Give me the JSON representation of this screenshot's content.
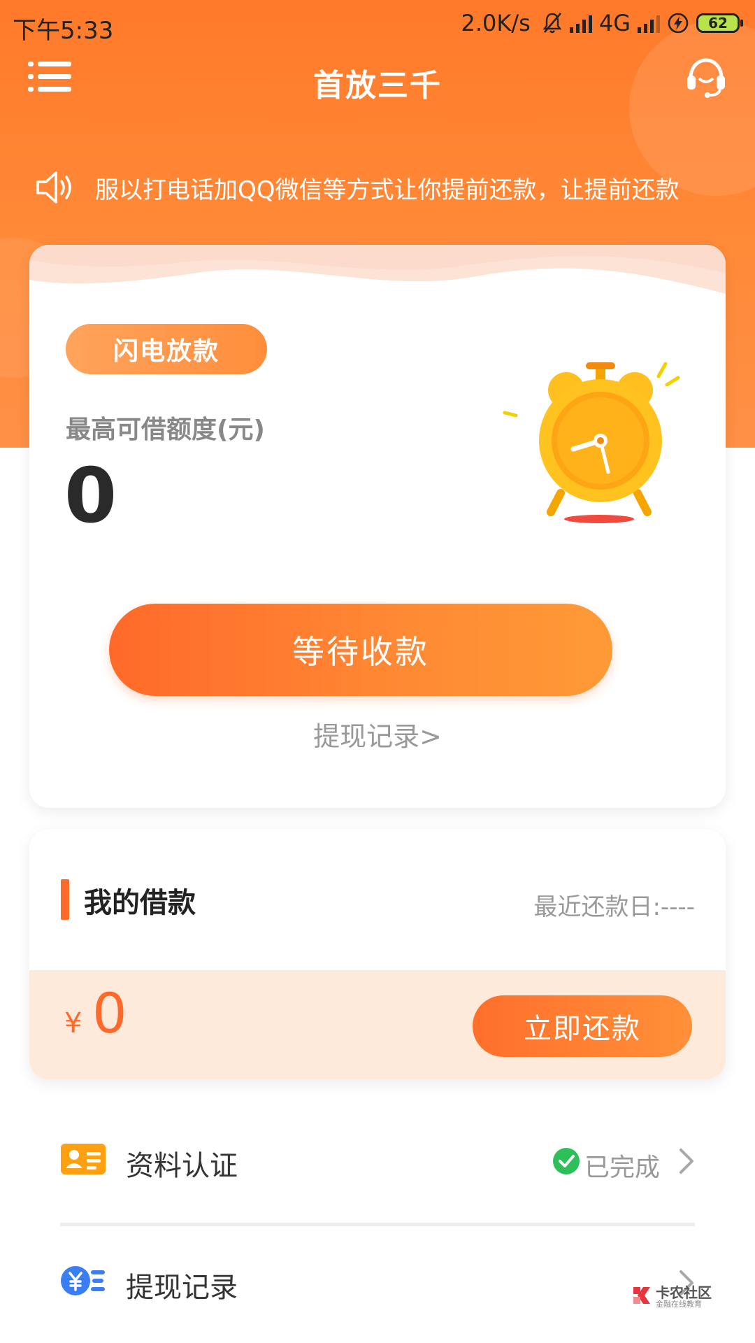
{
  "status_bar": {
    "time": "下午5:33",
    "speed": "2.0K/s",
    "network": "4G",
    "battery": "62"
  },
  "header": {
    "title": "首放三千",
    "menu_icon": "hamburger-menu-icon",
    "support_icon": "headset-icon"
  },
  "notice": {
    "text": "服以打电话加QQ微信等方式让你提前还款，让提前还款",
    "icon": "speaker-icon"
  },
  "loan_card": {
    "badge": "闪电放款",
    "limit_label": "最高可借额度(元)",
    "limit_value": "0",
    "receive_button": "等待收款",
    "withdraw_link": "提现记录>"
  },
  "my_loan": {
    "title": "我的借款",
    "recent_repay": "最近还款日:----",
    "currency": "¥",
    "amount": "0",
    "repay_button": "立即还款"
  },
  "menu_items": [
    {
      "label": "资料认证",
      "status": "已完成",
      "icon": "id-card-icon"
    },
    {
      "label": "提现记录",
      "icon": "yen-list-icon"
    }
  ],
  "watermark": {
    "title": "卡农社区",
    "subtitle": "金融在线教育"
  },
  "colors": {
    "brand_orange": "#ff7a2a",
    "success_green": "#2dbf5a",
    "pale_orange": "#feeadb"
  }
}
